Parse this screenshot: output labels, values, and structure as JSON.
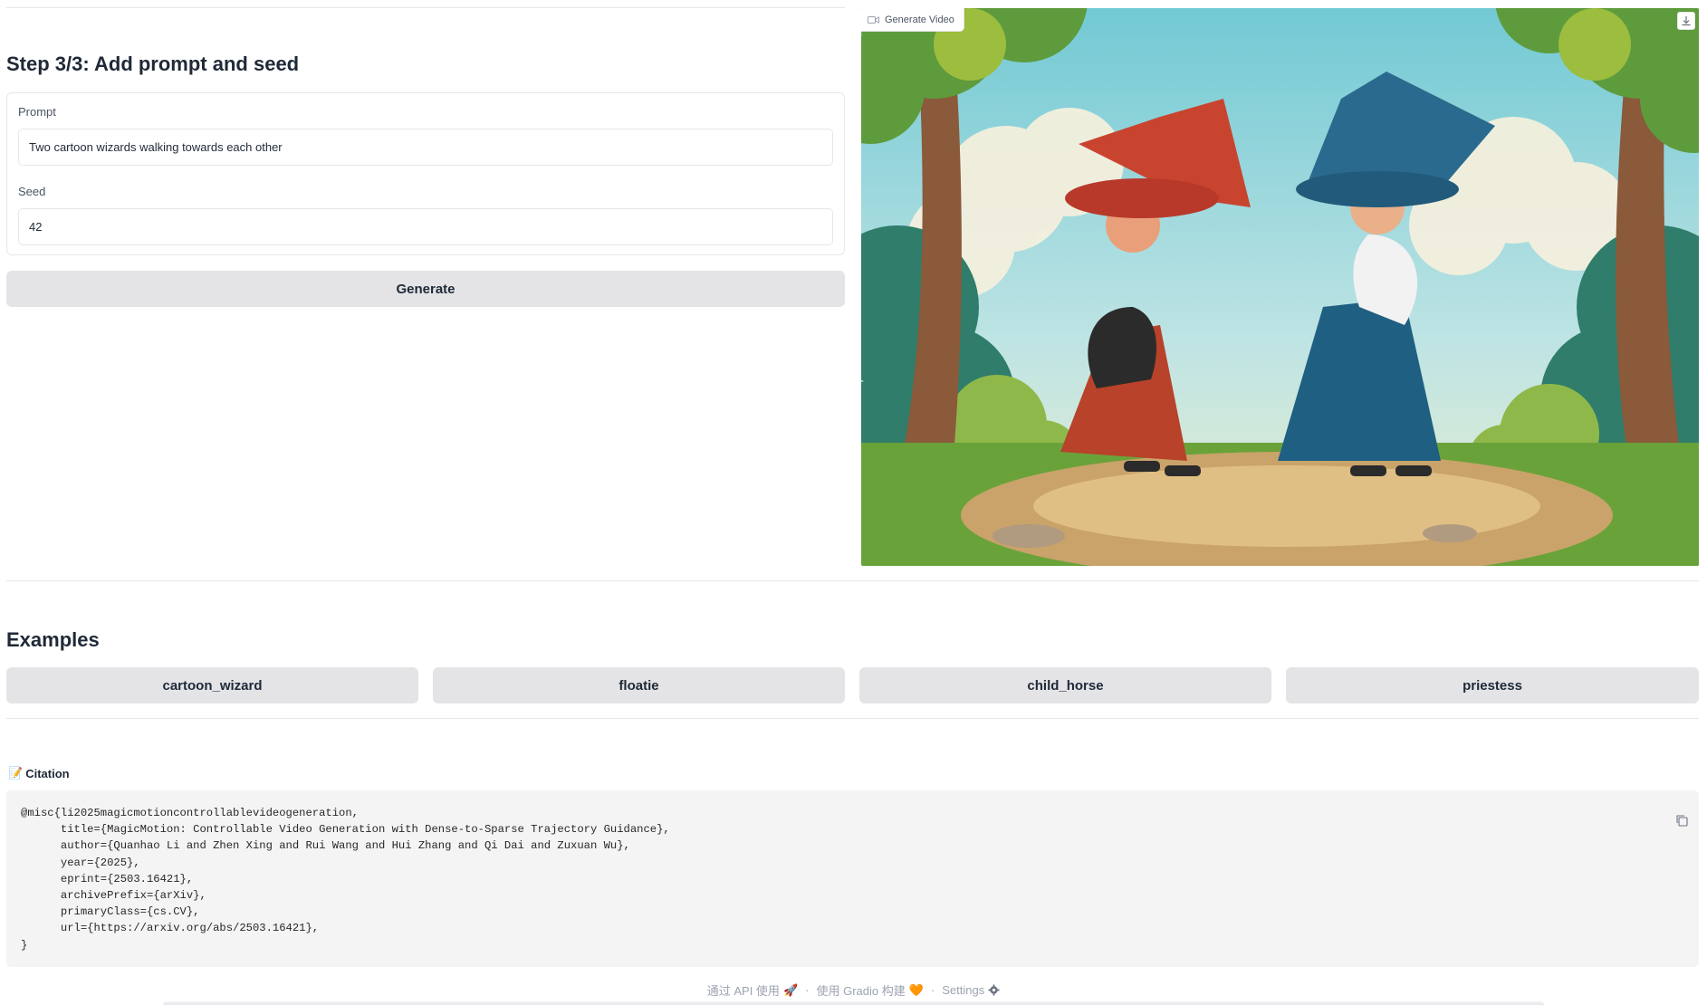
{
  "step": {
    "title": "Step 3/3: Add prompt and seed"
  },
  "form": {
    "prompt_label": "Prompt",
    "prompt_value": "Two cartoon wizards walking towards each other",
    "seed_label": "Seed",
    "seed_value": "42"
  },
  "generate_label": "Generate",
  "video": {
    "tag_label": "Generate Video",
    "icon": "video-icon",
    "download_icon": "download-icon"
  },
  "examples": {
    "title": "Examples",
    "items": [
      "cartoon_wizard",
      "floatie",
      "child_horse",
      "priestess"
    ]
  },
  "citation": {
    "emoji": "📝",
    "title": "Citation",
    "lines": [
      "@misc{li2025magicmotioncontrollablevideogeneration,",
      "      title={MagicMotion: Controllable Video Generation with Dense-to-Sparse Trajectory Guidance},",
      "      author={Quanhao Li and Zhen Xing and Rui Wang and Hui Zhang and Qi Dai and Zuxuan Wu},",
      "      year={2025},",
      "      eprint={2503.16421},",
      "      archivePrefix={arXiv},",
      "      primaryClass={cs.CV},",
      "      url={https://arxiv.org/abs/2503.16421},",
      "}"
    ],
    "copy_icon": "copy-icon"
  },
  "footer": {
    "api": "通过 API 使用",
    "api_emoji": "🚀",
    "sep": "·",
    "gradio": "使用 Gradio 构建",
    "gradio_emoji": "🧡",
    "settings": "Settings",
    "settings_icon": "gear-icon"
  },
  "colors": {
    "button_bg": "#e4e4e7",
    "code_bg": "#f4f4f5",
    "border": "#e5e7eb"
  }
}
